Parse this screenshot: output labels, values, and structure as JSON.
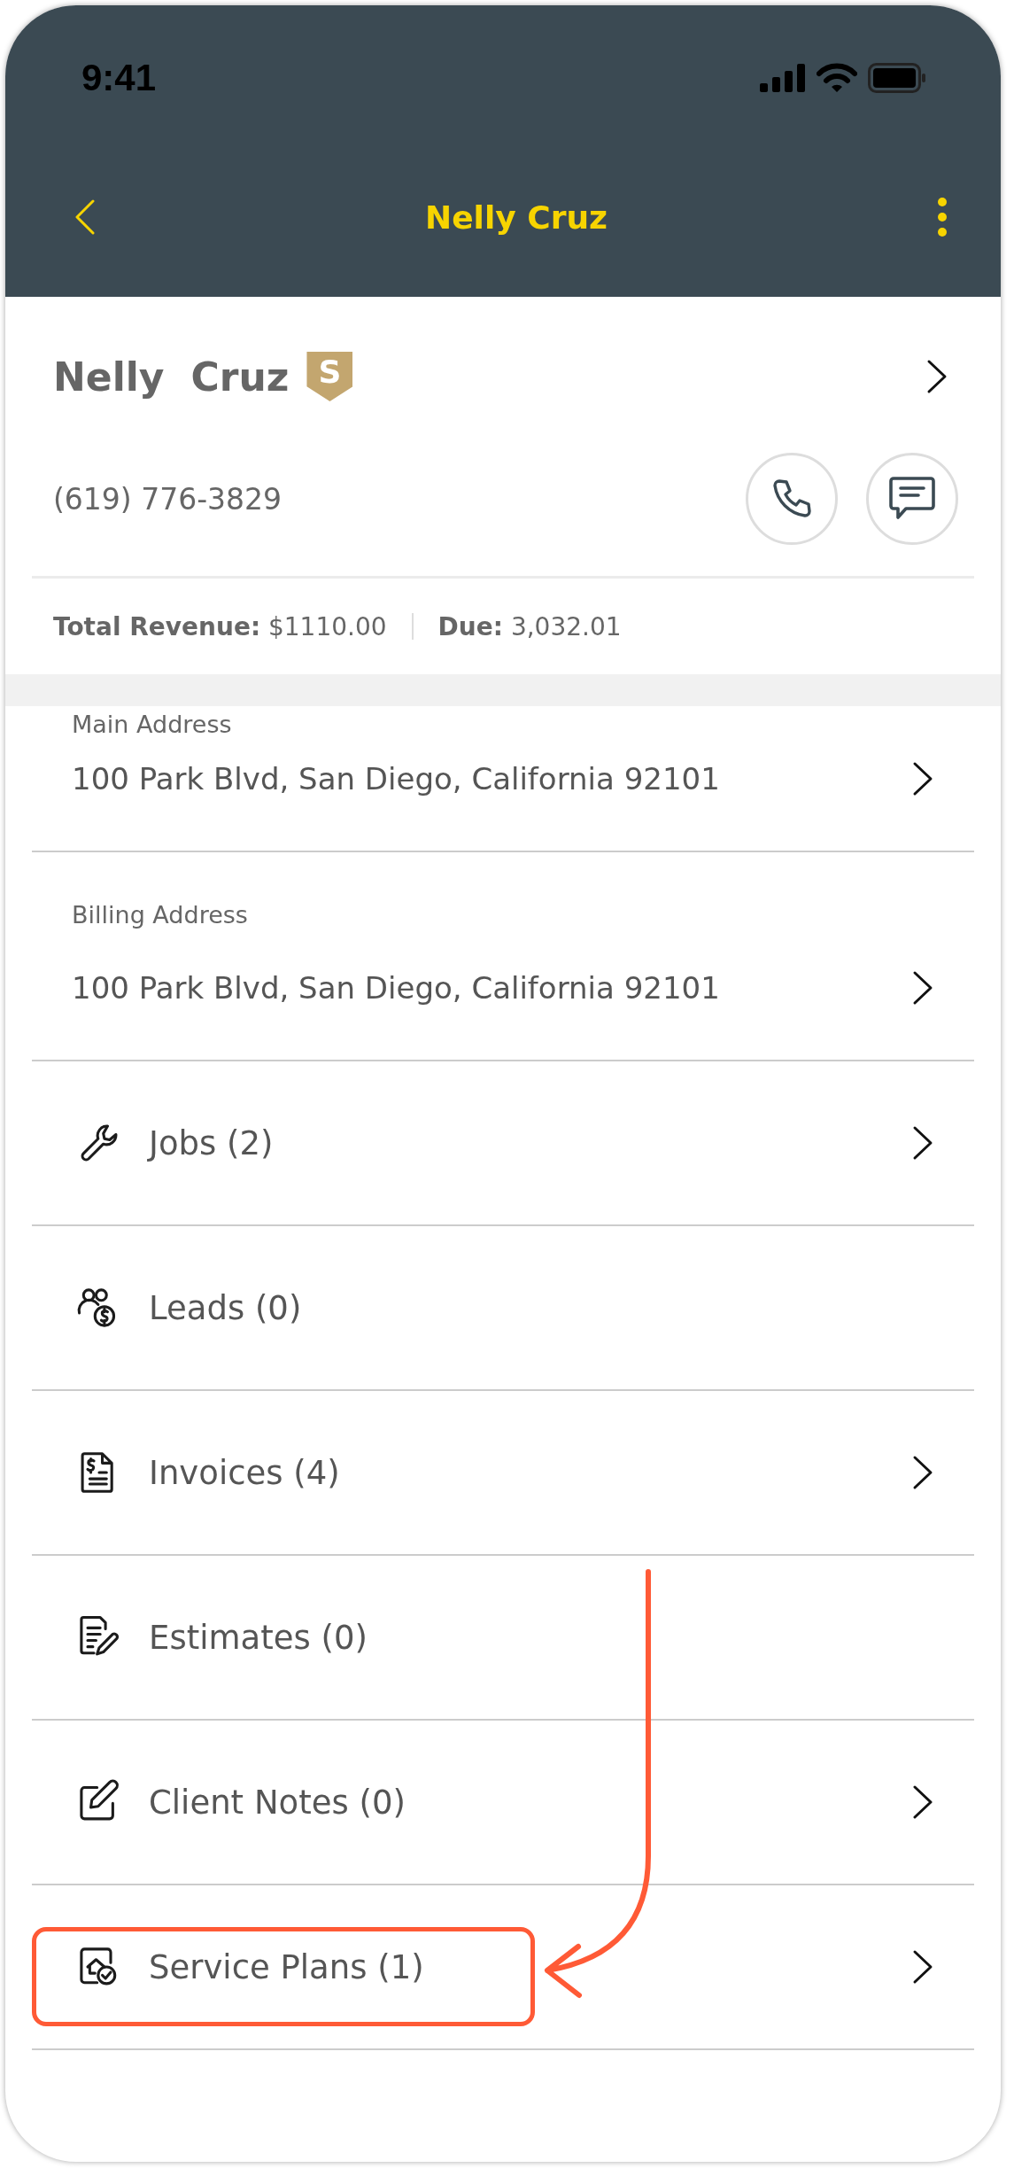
{
  "status_bar": {
    "time": "9:41"
  },
  "nav": {
    "title": "Nelly Cruz"
  },
  "client": {
    "first_name": "Nelly",
    "last_name": "Cruz",
    "badge": "S",
    "phone": "(619) 776-3829",
    "revenue": "**Total Revenue:** $1110.00",
    "due": "**Due:** 3,032.01"
  },
  "addresses": [
    {
      "label": "Main Address",
      "value": "100 Park Blvd, San Diego, California 92101"
    },
    {
      "label": "Billing Address",
      "value": "100 Park Blvd, San Diego, California 92101"
    }
  ],
  "sections": [
    {
      "label": "Jobs (2)",
      "chevron": true,
      "highlighted": false
    },
    {
      "label": "Leads (0)",
      "chevron": false,
      "highlighted": false
    },
    {
      "label": "Invoices (4)",
      "chevron": true,
      "highlighted": false
    },
    {
      "label": "Estimates (0)",
      "chevron": false,
      "highlighted": false
    },
    {
      "label": "Client Notes (0)",
      "chevron": true,
      "highlighted": false
    },
    {
      "label": "Service Plans (1)",
      "chevron": true,
      "highlighted": true
    }
  ]
}
